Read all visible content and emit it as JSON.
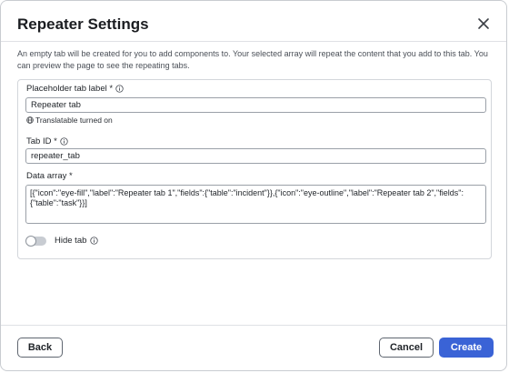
{
  "modal": {
    "title": "Repeater Settings",
    "intro": "An empty tab will be created for you to add components to. Your selected array will repeat the content that you add to this tab. You can preview the page to see the repeating tabs."
  },
  "fields": {
    "placeholder_label": "Placeholder tab label *",
    "placeholder_value": "Repeater tab",
    "translatable_note": "Translatable turned on",
    "tab_id_label": "Tab ID *",
    "tab_id_value": "repeater_tab",
    "data_array_label": "Data array *",
    "data_array_value": "[{\"icon\":\"eye-fill\",\"label\":\"Repeater tab 1\",\"fields\":{\"table\":\"incident\"}},{\"icon\":\"eye-outline\",\"label\":\"Repeater tab 2\",\"fields\":{\"table\":\"task\"}}]",
    "hide_tab_label": "Hide tab",
    "hide_tab_on": false
  },
  "footer": {
    "back": "Back",
    "cancel": "Cancel",
    "create": "Create"
  },
  "colors": {
    "primary": "#3a63d6",
    "border": "#9aa0a8"
  },
  "icons": [
    "close-icon",
    "info-icon",
    "globe-icon"
  ]
}
